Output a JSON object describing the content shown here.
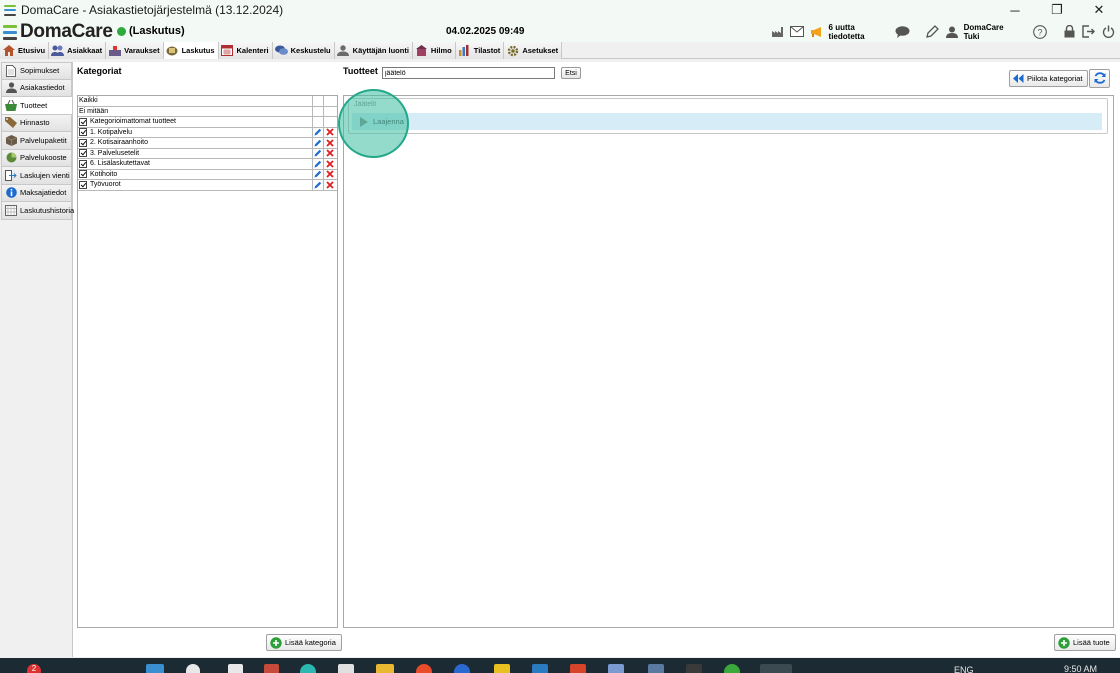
{
  "window": {
    "title": "DomaCare - Asiakastietojärjestelmä (13.12.2024)",
    "minimize_glyph": "─",
    "restore_glyph": "❐",
    "close_glyph": "✕"
  },
  "header": {
    "app_name": "DomaCare",
    "context": "(Laskutus)",
    "datetime": "04.02.2025 09:49",
    "notifications": "6 uutta tiedotetta",
    "user": "DomaCare Tuki"
  },
  "mainnav": [
    {
      "label": "Etusivu",
      "icon": "home-icon"
    },
    {
      "label": "Asiakkaat",
      "icon": "customers-icon"
    },
    {
      "label": "Varaukset",
      "icon": "bookings-icon"
    },
    {
      "label": "Laskutus",
      "icon": "billing-icon"
    },
    {
      "label": "Kalenteri",
      "icon": "calendar-icon"
    },
    {
      "label": "Keskustelu",
      "icon": "chat-icon"
    },
    {
      "label": "Käyttäjän luonti",
      "icon": "user-create-icon"
    },
    {
      "label": "Hilmo",
      "icon": "hilmo-icon"
    },
    {
      "label": "Tilastot",
      "icon": "statistics-icon"
    },
    {
      "label": "Asetukset",
      "icon": "settings-icon"
    }
  ],
  "sidenav": [
    {
      "label": "Sopimukset",
      "icon": "document-icon"
    },
    {
      "label": "Asiakastiedot",
      "icon": "person-icon"
    },
    {
      "label": "Tuotteet",
      "icon": "basket-icon"
    },
    {
      "label": "Hinnasto",
      "icon": "price-tag-icon"
    },
    {
      "label": "Palvelupaketit",
      "icon": "package-icon"
    },
    {
      "label": "Palvelukooste",
      "icon": "pie-icon"
    },
    {
      "label": "Laskujen vienti",
      "icon": "export-icon"
    },
    {
      "label": "Maksajatiedot",
      "icon": "info-icon"
    },
    {
      "label": "Laskutushistoria",
      "icon": "history-icon"
    }
  ],
  "categories": {
    "title": "Kategoriat",
    "rows": [
      {
        "label": "Kaikki",
        "checkbox": false,
        "actions": false
      },
      {
        "label": "Ei mitään",
        "checkbox": false,
        "actions": false
      },
      {
        "label": "Kategorioimattomat tuotteet",
        "checkbox": true,
        "actions": false
      },
      {
        "label": "1. Kotipalvelu",
        "checkbox": true,
        "actions": true
      },
      {
        "label": "2. Kotisairaanhoito",
        "checkbox": true,
        "actions": true
      },
      {
        "label": "3. Palvelusetelit",
        "checkbox": true,
        "actions": true
      },
      {
        "label": "6. Lisälaskutettavat",
        "checkbox": true,
        "actions": true
      },
      {
        "label": "Kotihoito",
        "checkbox": true,
        "actions": true
      },
      {
        "label": "Työvuorot",
        "checkbox": true,
        "actions": true
      }
    ],
    "add_button": "Lisää kategoria"
  },
  "products": {
    "title": "Tuotteet",
    "search_value": "jäätelö",
    "search_button": "Etsi",
    "hide_categories_button": "Piilota kategoriat",
    "group_title": "Jäätelö",
    "expand_label": "Laajenna",
    "add_button": "Lisää tuote"
  },
  "taskbar": {
    "language": "ENG",
    "time": "9:50 AM",
    "badge": "2"
  },
  "colors": {
    "accent_green": "#2eaa3a",
    "highlight": "#3cbea0",
    "row_selected": "#d6edf8",
    "delete_red": "#e02020",
    "edit_blue": "#1e6fd0"
  }
}
